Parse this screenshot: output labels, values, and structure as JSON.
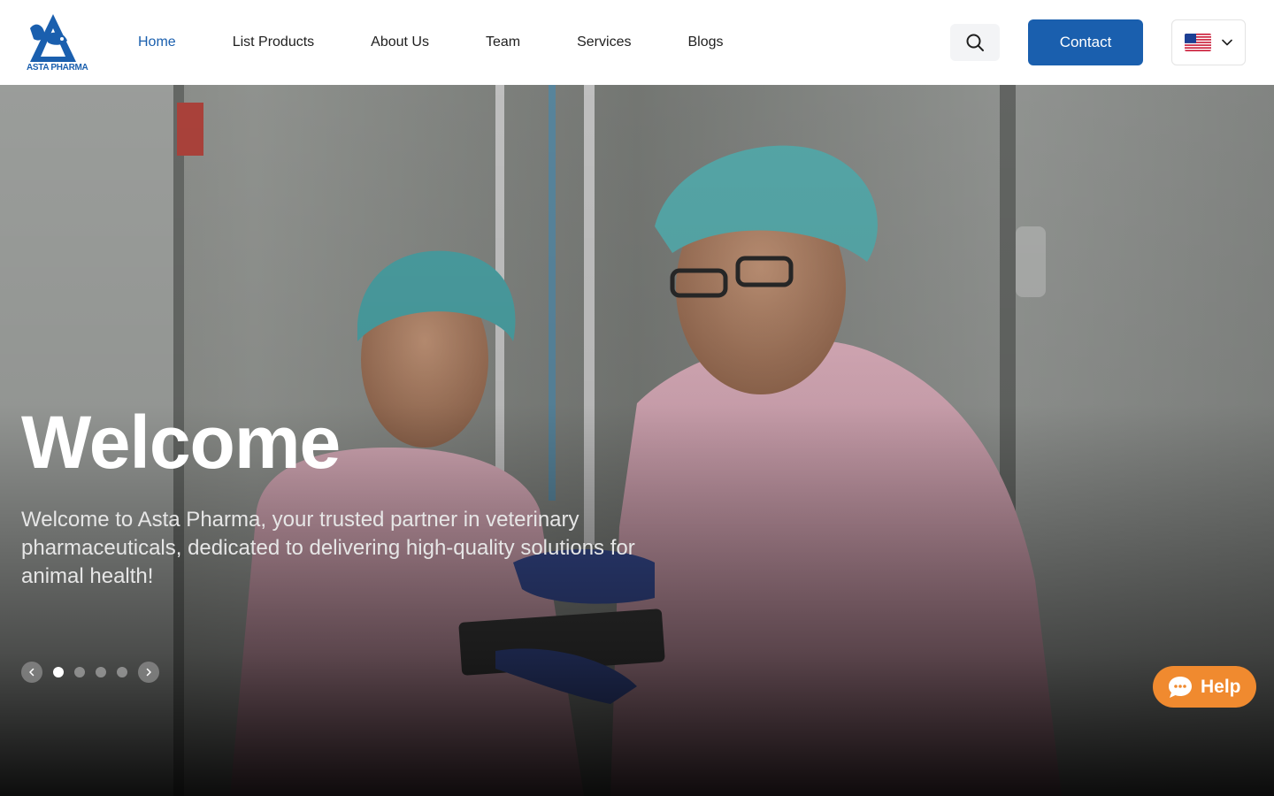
{
  "brand": {
    "logo_text": "ASTA PHARMA"
  },
  "nav": {
    "items": [
      {
        "label": "Home",
        "active": true
      },
      {
        "label": "List Products",
        "active": false
      },
      {
        "label": "About Us",
        "active": false
      },
      {
        "label": "Team",
        "active": false
      },
      {
        "label": "Services",
        "active": false
      },
      {
        "label": "Blogs",
        "active": false
      }
    ]
  },
  "header": {
    "search_icon": "search-icon",
    "contact_label": "Contact",
    "language_flag": "us-flag-icon"
  },
  "hero": {
    "title": "Welcome",
    "subtitle": "Welcome to Asta Pharma, your trusted partner in veterinary pharmaceuticals, dedicated to delivering high-quality solutions for animal health!",
    "slides_count": 4,
    "active_slide": 1
  },
  "help": {
    "label": "Help",
    "icon": "chat-bubble-icon"
  },
  "colors": {
    "brand_blue": "#1a5fae",
    "help_orange": "#f08a2f"
  }
}
